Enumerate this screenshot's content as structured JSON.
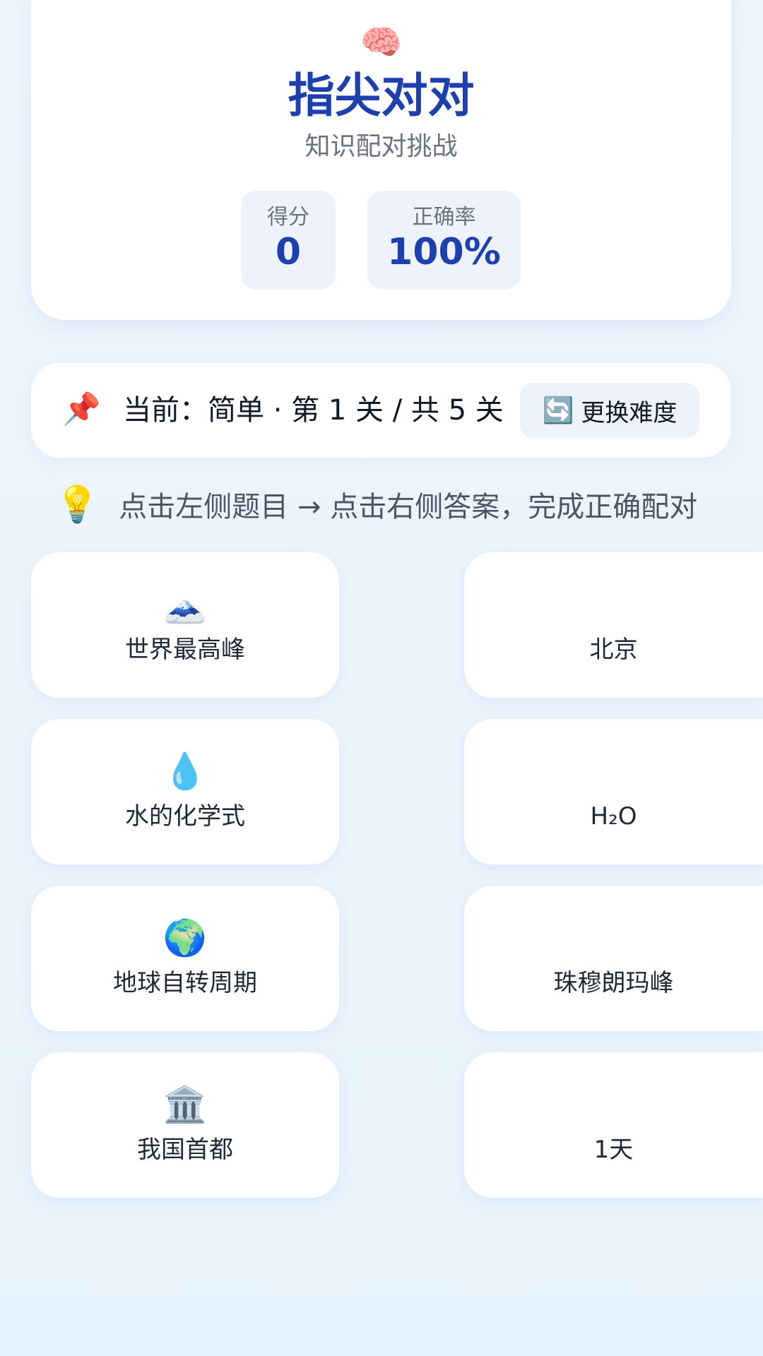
{
  "header": {
    "icon": "brain-icon",
    "title": "指尖对对",
    "subtitle": "知识配对挑战",
    "stats": {
      "score_label": "得分",
      "score_value": "0",
      "accuracy_label": "正确率",
      "accuracy_value": "100%"
    }
  },
  "level_bar": {
    "icon": "pushpin-icon",
    "text": "当前：简单 · 第 1 关 / 共 5 关",
    "change_button_icon": "refresh-icon",
    "change_button_label": "更换难度"
  },
  "hint": {
    "icon": "lightbulb-icon",
    "text": "点击左侧题目 → 点击右侧答案，完成正确配对"
  },
  "questions": [
    {
      "icon": "mountain-icon",
      "label": "世界最高峰"
    },
    {
      "icon": "droplet-icon",
      "label": "水的化学式"
    },
    {
      "icon": "globe-icon",
      "label": "地球自转周期"
    },
    {
      "icon": "classical-building-icon",
      "label": "我国首都"
    }
  ],
  "answers": [
    {
      "label": "北京"
    },
    {
      "label": "H₂O"
    },
    {
      "label": "珠穆朗玛峰"
    },
    {
      "label": "1天"
    }
  ],
  "colors": {
    "accent": "#1e40af",
    "background": "#e7f3fc",
    "card": "#ffffff",
    "stat_bg": "#eef3fb"
  }
}
